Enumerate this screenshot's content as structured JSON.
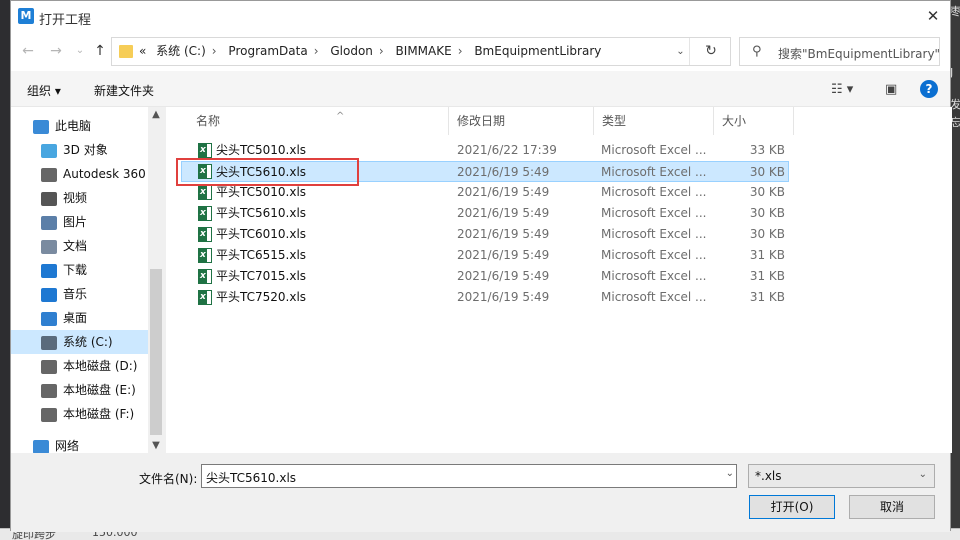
{
  "window": {
    "title": "打开工程",
    "close_glyph": "✕"
  },
  "background": {
    "right_text": [
      "枣",
      "J",
      "发",
      "忘"
    ],
    "bottom_left": "旋印跨步",
    "bottom_value": "150.000"
  },
  "nav": {
    "back": "←",
    "forward": "→",
    "history": "⌄",
    "up": "↑",
    "breadcrumbs": [
      "系统 (C:)",
      "ProgramData",
      "Glodon",
      "BIMMAKE",
      "BmEquipmentLibrary"
    ],
    "prefix": "«",
    "separator": "›",
    "search_placeholder": "搜索\"BmEquipmentLibrary\""
  },
  "toolbar": {
    "organize": "组织 ▾",
    "new_folder": "新建文件夹",
    "view_glyph": "☷ ▾",
    "pane_glyph": "▣",
    "help_glyph": "?"
  },
  "sidebar": {
    "items": [
      {
        "label": "此电脑",
        "icon": "computer-icon",
        "color": "#3a8ad6"
      },
      {
        "label": "3D 对象",
        "icon": "cube-icon",
        "color": "#48a6e0"
      },
      {
        "label": "Autodesk 360",
        "icon": "cloud-icon",
        "color": "#666666"
      },
      {
        "label": "视频",
        "icon": "video-icon",
        "color": "#555555"
      },
      {
        "label": "图片",
        "icon": "picture-icon",
        "color": "#5b7fa8"
      },
      {
        "label": "文档",
        "icon": "document-icon",
        "color": "#7a8ba0"
      },
      {
        "label": "下载",
        "icon": "download-icon",
        "color": "#1e78d2"
      },
      {
        "label": "音乐",
        "icon": "music-icon",
        "color": "#1e78d2"
      },
      {
        "label": "桌面",
        "icon": "desktop-icon",
        "color": "#2f7fd0"
      },
      {
        "label": "系统 (C:)",
        "icon": "drive-c-icon",
        "color": "#5a6b7c",
        "selected": true
      },
      {
        "label": "本地磁盘 (D:)",
        "icon": "drive-icon",
        "color": "#666666"
      },
      {
        "label": "本地磁盘 (E:)",
        "icon": "drive-icon",
        "color": "#666666"
      },
      {
        "label": "本地磁盘 (F:)",
        "icon": "drive-icon",
        "color": "#666666"
      },
      {
        "label": "网络",
        "icon": "network-icon",
        "color": "#3a8ad6"
      }
    ]
  },
  "columns": {
    "name": "名称",
    "date": "修改日期",
    "type": "类型",
    "size": "大小"
  },
  "files": [
    {
      "name": "尖头TC5010.xls",
      "date": "2021/6/22 17:39",
      "type": "Microsoft Excel ...",
      "size": "33 KB"
    },
    {
      "name": "尖头TC5610.xls",
      "date": "2021/6/19 5:49",
      "type": "Microsoft Excel ...",
      "size": "30 KB",
      "selected": true
    },
    {
      "name": "平头TC5010.xls",
      "date": "2021/6/19 5:49",
      "type": "Microsoft Excel ...",
      "size": "30 KB"
    },
    {
      "name": "平头TC5610.xls",
      "date": "2021/6/19 5:49",
      "type": "Microsoft Excel ...",
      "size": "30 KB"
    },
    {
      "name": "平头TC6010.xls",
      "date": "2021/6/19 5:49",
      "type": "Microsoft Excel ...",
      "size": "30 KB"
    },
    {
      "name": "平头TC6515.xls",
      "date": "2021/6/19 5:49",
      "type": "Microsoft Excel ...",
      "size": "31 KB"
    },
    {
      "name": "平头TC7015.xls",
      "date": "2021/6/19 5:49",
      "type": "Microsoft Excel ...",
      "size": "31 KB"
    },
    {
      "name": "平头TC7520.xls",
      "date": "2021/6/19 5:49",
      "type": "Microsoft Excel ...",
      "size": "31 KB"
    }
  ],
  "footer": {
    "filename_label": "文件名(N):",
    "filename_value": "尖头TC5610.xls",
    "filetype_value": "*.xls",
    "open_label": "打开(O)",
    "cancel_label": "取消"
  }
}
